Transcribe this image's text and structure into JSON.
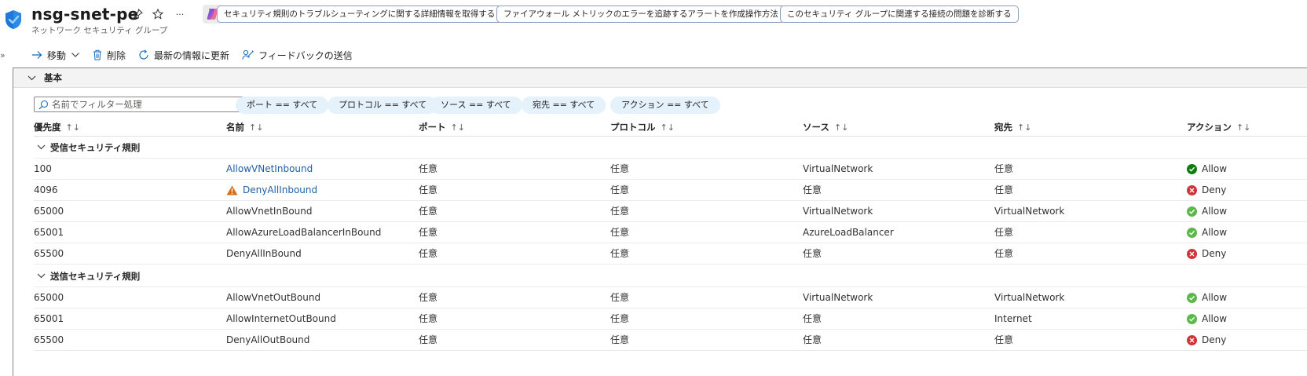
{
  "header": {
    "title": "nsg-snet-pe",
    "subtitle": "ネットワーク セキュリティ グループ",
    "more": "···",
    "suggestions": [
      "セキュリティ規則のトラブルシューティングに関する詳細情報を取得する",
      "ファイアウォール メトリックのエラーを追跡するアラートを作成操作方法",
      "このセキュリティ グループに関連する接続の問題を診断する"
    ]
  },
  "toolbar": {
    "collapse": "»",
    "move": "移動",
    "delete": "削除",
    "refresh": "最新の情報に更新",
    "feedback": "フィードバックの送信"
  },
  "section": {
    "label": "基本"
  },
  "filters": {
    "placeholder": "名前でフィルター処理",
    "chips": [
      "ポート == すべて",
      "プロトコル == すべて",
      "ソース == すべて",
      "宛先 == すべて",
      "アクション == すべて"
    ]
  },
  "table": {
    "columns": [
      "優先度",
      "名前",
      "ポート",
      "プロトコル",
      "ソース",
      "宛先",
      "アクション"
    ],
    "sort_glyph": "↑↓",
    "groups": [
      {
        "label": "受信セキュリティ規則",
        "rows": [
          {
            "priority": "100",
            "name": "AllowVNetInbound",
            "port": "任意",
            "protocol": "任意",
            "source": "VirtualNetwork",
            "dest": "任意",
            "action": "Allow"
          },
          {
            "priority": "4096",
            "name": "DenyAllInbound",
            "port": "任意",
            "protocol": "任意",
            "source": "任意",
            "dest": "任意",
            "action": "Deny"
          },
          {
            "priority": "65000",
            "name": "AllowVnetInBound",
            "port": "任意",
            "protocol": "任意",
            "source": "VirtualNetwork",
            "dest": "VirtualNetwork",
            "action": "Allow"
          },
          {
            "priority": "65001",
            "name": "AllowAzureLoadBalancerInBound",
            "port": "任意",
            "protocol": "任意",
            "source": "AzureLoadBalancer",
            "dest": "任意",
            "action": "Allow"
          },
          {
            "priority": "65500",
            "name": "DenyAllInBound",
            "port": "任意",
            "protocol": "任意",
            "source": "任意",
            "dest": "任意",
            "action": "Deny"
          }
        ]
      },
      {
        "label": "送信セキュリティ規則",
        "rows": [
          {
            "priority": "65000",
            "name": "AllowVnetOutBound",
            "port": "任意",
            "protocol": "任意",
            "source": "VirtualNetwork",
            "dest": "VirtualNetwork",
            "action": "Allow"
          },
          {
            "priority": "65001",
            "name": "AllowInternetOutBound",
            "port": "任意",
            "protocol": "任意",
            "source": "任意",
            "dest": "Internet",
            "action": "Allow"
          },
          {
            "priority": "65500",
            "name": "DenyAllOutBound",
            "port": "任意",
            "protocol": "任意",
            "source": "任意",
            "dest": "任意",
            "action": "Deny"
          }
        ]
      }
    ]
  },
  "colors": {
    "link": "#1f5fa8",
    "allow_strong": "#107c10",
    "allow_light": "#5db84a",
    "deny": "#d13438",
    "warning": "#d86d1a",
    "chip_bg": "#e5f1fb",
    "shield": "#1e78d4"
  }
}
